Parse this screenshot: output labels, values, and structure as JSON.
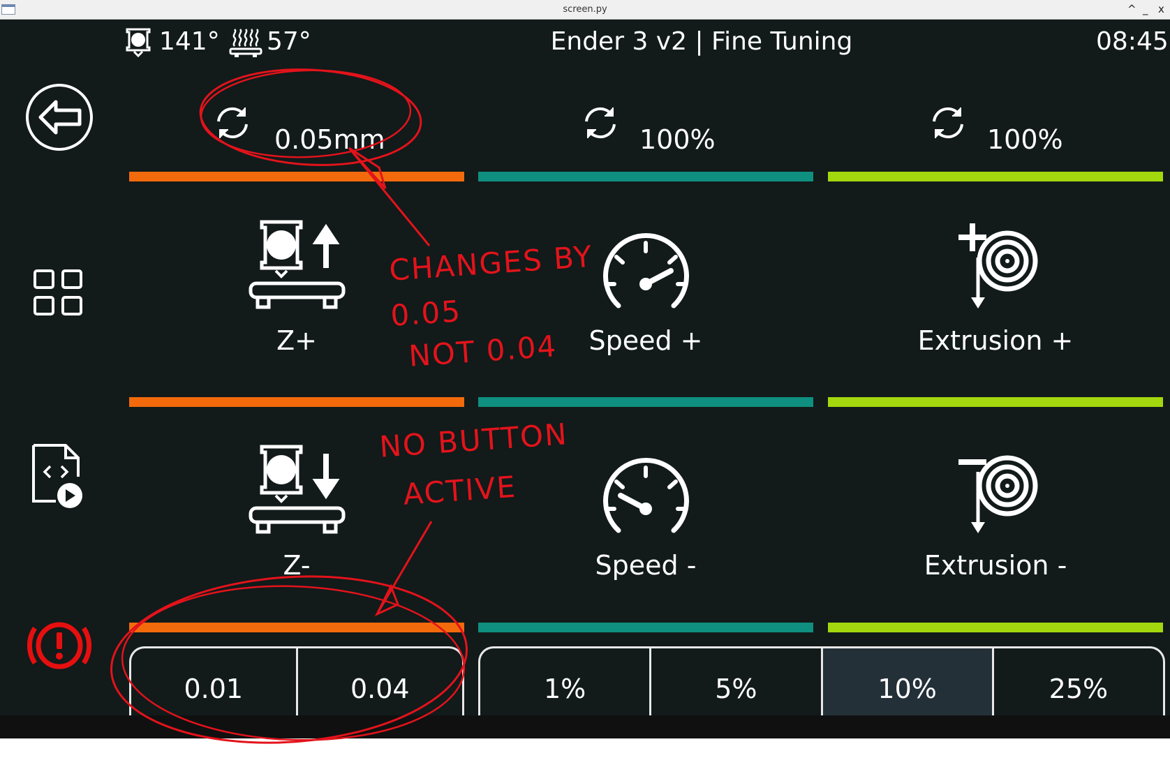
{
  "window": {
    "title": "screen.py",
    "controls": [
      "^",
      "_",
      "x"
    ]
  },
  "header": {
    "extruder_temp": "141°",
    "bed_temp": "57°",
    "title": "Ender 3 v2 | Fine Tuning",
    "time": "08:45"
  },
  "sidebar": {
    "items": [
      {
        "name": "back",
        "icon": "back-arrow-icon"
      },
      {
        "name": "menu",
        "icon": "grid-icon"
      },
      {
        "name": "macros",
        "icon": "file-code-play-icon"
      },
      {
        "name": "emergency-stop",
        "icon": "alert-icon"
      }
    ]
  },
  "columns": {
    "z": {
      "reset_value": "0.05mm",
      "up_label": "Z+",
      "down_label": "Z-",
      "color": "#f26a0c",
      "steps": [
        "0.01",
        "0.04"
      ],
      "active_step": null
    },
    "speed": {
      "reset_value": "100%",
      "up_label": "Speed +",
      "down_label": "Speed -",
      "color": "#0f8f7f"
    },
    "extrusion": {
      "reset_value": "100%",
      "up_label": "Extrusion +",
      "down_label": "Extrusion -",
      "color": "#a3d80e"
    }
  },
  "percent_steps": {
    "options": [
      "1%",
      "5%",
      "10%",
      "25%"
    ],
    "active": "10%"
  },
  "annotations": {
    "note1_line1": "CHANGES BY",
    "note1_line2": "0.05",
    "note1_line3": "NOT 0.04",
    "note2_line1": "NO BUTTON",
    "note2_line2": "ACTIVE",
    "color": "#e3131b"
  }
}
